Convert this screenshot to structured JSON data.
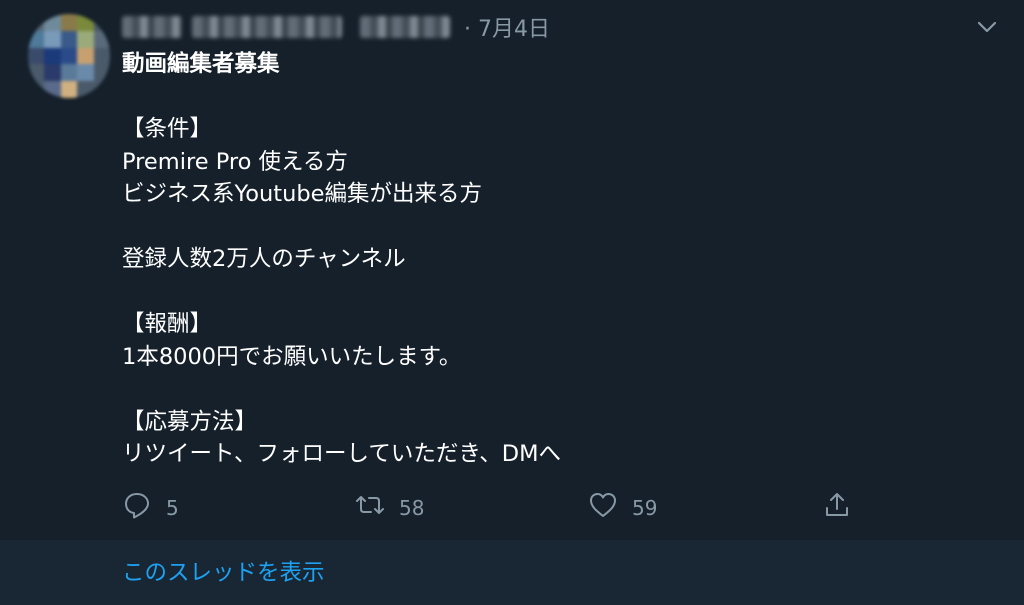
{
  "tweet": {
    "author": {
      "avatar_colors": [
        "#5a6a7a",
        "#6f8a9a",
        "#8a7a4a",
        "#7a8a3a",
        "#4a5a6a",
        "#4f7a9a",
        "#7a9aba",
        "#3a5a8a",
        "#9aaa7a",
        "#5a6a7a",
        "#3a4a6a",
        "#1a3a7a",
        "#2a4a8a",
        "#c8a070",
        "#4a5a6a",
        "#4a5a6a",
        "#2a3a6a",
        "#5a7a9a",
        "#6a8aaa",
        "#4a5a6a",
        "#4a5a6a",
        "#5a6a8a",
        "#d0b080",
        "#4a5a6a",
        "#4a5a6a"
      ]
    },
    "date": "· 7月4日",
    "lines": [
      "動画編集者募集",
      "",
      "【条件】",
      "Premire Pro 使える方",
      "ビジネス系Youtube編集が出来る方",
      "",
      "登録人数2万人のチャンネル",
      "",
      "【報酬】",
      "1本8000円でお願いいたします。",
      "",
      "【応募方法】",
      "リツイート、フォローしていただき、DMへ"
    ],
    "actions": {
      "reply": {
        "icon": "reply-icon",
        "count": "5"
      },
      "retweet": {
        "icon": "retweet-icon",
        "count": "58"
      },
      "like": {
        "icon": "heart-icon",
        "count": "59"
      },
      "share": {
        "icon": "share-icon"
      }
    }
  },
  "thread": {
    "link_label": "このスレッドを表示",
    "link_color": "#1da1f2"
  },
  "colors": {
    "background": "#15202b",
    "thread_background": "#192734",
    "muted": "#8899a6"
  }
}
